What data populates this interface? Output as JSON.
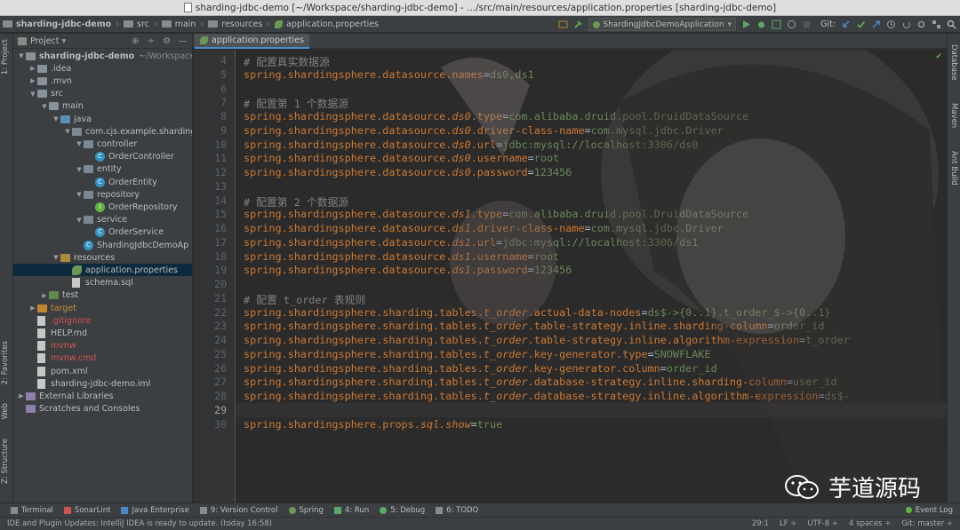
{
  "window": {
    "title": "sharding-jdbc-demo [~/Workspace/sharding-jdbc-demo] - .../src/main/resources/application.properties [sharding-jdbc-demo]"
  },
  "navbar": {
    "crumbs": [
      "sharding-jdbc-demo",
      "src",
      "main",
      "resources",
      "application.properties"
    ],
    "run_config": "ShardingJdbcDemoApplication",
    "git_label": "Git:"
  },
  "left_stripe": {
    "project": "1: Project",
    "favorites": "2: Favorites",
    "web": "Web",
    "structure": "Z: Structure"
  },
  "right_stripe": {
    "database": "Database",
    "maven": "Maven",
    "ant": "Ant Build"
  },
  "project_panel": {
    "header": "Project",
    "tree": [
      {
        "label": "sharding-jdbc-demo",
        "extra": "~/Workspace/s",
        "icon": "folder",
        "indent": 0,
        "arrow": "down",
        "bold": true
      },
      {
        "label": ".idea",
        "icon": "folder",
        "indent": 1,
        "arrow": "right"
      },
      {
        "label": ".mvn",
        "icon": "folder",
        "indent": 1,
        "arrow": "right"
      },
      {
        "label": "src",
        "icon": "folder",
        "indent": 1,
        "arrow": "down"
      },
      {
        "label": "main",
        "icon": "folder",
        "indent": 2,
        "arrow": "down"
      },
      {
        "label": "java",
        "icon": "folder-src",
        "indent": 3,
        "arrow": "down"
      },
      {
        "label": "com.cjs.example.sharding",
        "icon": "pkg",
        "indent": 4,
        "arrow": "down"
      },
      {
        "label": "controller",
        "icon": "pkg",
        "indent": 5,
        "arrow": "down"
      },
      {
        "label": "OrderController",
        "icon": "cls",
        "indent": 6,
        "arrow": ""
      },
      {
        "label": "entity",
        "icon": "pkg",
        "indent": 5,
        "arrow": "down"
      },
      {
        "label": "OrderEntity",
        "icon": "cls",
        "indent": 6,
        "arrow": ""
      },
      {
        "label": "repository",
        "icon": "pkg",
        "indent": 5,
        "arrow": "down"
      },
      {
        "label": "OrderRepository",
        "icon": "itf",
        "indent": 6,
        "arrow": ""
      },
      {
        "label": "service",
        "icon": "pkg",
        "indent": 5,
        "arrow": "down"
      },
      {
        "label": "OrderService",
        "icon": "cls",
        "indent": 6,
        "arrow": ""
      },
      {
        "label": "ShardingJdbcDemoAp",
        "icon": "cls",
        "indent": 5,
        "arrow": ""
      },
      {
        "label": "resources",
        "icon": "folder-res",
        "indent": 3,
        "arrow": "down"
      },
      {
        "label": "application.properties",
        "icon": "leaf",
        "indent": 4,
        "arrow": "",
        "selected": true
      },
      {
        "label": "schema.sql",
        "icon": "file",
        "indent": 4,
        "arrow": ""
      },
      {
        "label": "test",
        "icon": "folder-test",
        "indent": 2,
        "arrow": "right"
      },
      {
        "label": "target",
        "icon": "folder-target",
        "indent": 1,
        "arrow": "right"
      },
      {
        "label": ".gitignore",
        "icon": "file",
        "indent": 1,
        "arrow": "",
        "color": "red"
      },
      {
        "label": "HELP.md",
        "icon": "file",
        "indent": 1,
        "arrow": ""
      },
      {
        "label": "mvnw",
        "icon": "file",
        "indent": 1,
        "arrow": "",
        "color": "red"
      },
      {
        "label": "mvnw.cmd",
        "icon": "file",
        "indent": 1,
        "arrow": "",
        "color": "red"
      },
      {
        "label": "pom.xml",
        "icon": "file",
        "indent": 1,
        "arrow": ""
      },
      {
        "label": "sharding-jdbc-demo.iml",
        "icon": "file",
        "indent": 1,
        "arrow": ""
      },
      {
        "label": "External Libraries",
        "icon": "lib",
        "indent": 0,
        "arrow": "right"
      },
      {
        "label": "Scratches and Consoles",
        "icon": "lib",
        "indent": 0,
        "arrow": ""
      }
    ]
  },
  "editor": {
    "tab": "application.properties",
    "current_line": 29,
    "lines": [
      {
        "n": 4,
        "segs": [
          [
            "cm",
            "# 配置真实数据源"
          ]
        ]
      },
      {
        "n": 5,
        "segs": [
          [
            "k",
            "spring.shardingsphere.datasource.names"
          ],
          [
            "p",
            "="
          ],
          [
            "v",
            "ds0,ds1"
          ]
        ]
      },
      {
        "n": 6,
        "segs": []
      },
      {
        "n": 7,
        "segs": [
          [
            "cm",
            "# 配置第 1 个数据源"
          ]
        ]
      },
      {
        "n": 8,
        "segs": [
          [
            "k",
            "spring.shardingsphere.datasource."
          ],
          [
            "ki",
            "ds0"
          ],
          [
            "k",
            ".type"
          ],
          [
            "p",
            "="
          ],
          [
            "v",
            "com.alibaba.druid.pool.DruidDataSource"
          ]
        ]
      },
      {
        "n": 9,
        "segs": [
          [
            "k",
            "spring.shardingsphere.datasource."
          ],
          [
            "ki",
            "ds0"
          ],
          [
            "k",
            ".driver-class-name"
          ],
          [
            "p",
            "="
          ],
          [
            "v",
            "com.mysql.jdbc.Driver"
          ]
        ]
      },
      {
        "n": 10,
        "segs": [
          [
            "k",
            "spring.shardingsphere.datasource."
          ],
          [
            "ki",
            "ds0"
          ],
          [
            "k",
            ".url"
          ],
          [
            "p",
            "="
          ],
          [
            "v",
            "jdbc:mysql://localhost:3306/ds0"
          ]
        ]
      },
      {
        "n": 11,
        "segs": [
          [
            "k",
            "spring.shardingsphere.datasource."
          ],
          [
            "ki",
            "ds0"
          ],
          [
            "k",
            ".username"
          ],
          [
            "p",
            "="
          ],
          [
            "v",
            "root"
          ]
        ]
      },
      {
        "n": 12,
        "segs": [
          [
            "k",
            "spring.shardingsphere.datasource."
          ],
          [
            "ki",
            "ds0"
          ],
          [
            "k",
            ".password"
          ],
          [
            "p",
            "="
          ],
          [
            "v",
            "123456"
          ]
        ]
      },
      {
        "n": 13,
        "segs": []
      },
      {
        "n": 14,
        "segs": [
          [
            "cm",
            "# 配置第 2 个数据源"
          ]
        ]
      },
      {
        "n": 15,
        "segs": [
          [
            "k",
            "spring.shardingsphere.datasource."
          ],
          [
            "ki",
            "ds1"
          ],
          [
            "k",
            ".type"
          ],
          [
            "p",
            "="
          ],
          [
            "v",
            "com.alibaba.druid.pool.DruidDataSource"
          ]
        ]
      },
      {
        "n": 16,
        "segs": [
          [
            "k",
            "spring.shardingsphere.datasource."
          ],
          [
            "ki",
            "ds1"
          ],
          [
            "k",
            ".driver-class-name"
          ],
          [
            "p",
            "="
          ],
          [
            "v",
            "com.mysql.jdbc.Driver"
          ]
        ]
      },
      {
        "n": 17,
        "segs": [
          [
            "k",
            "spring.shardingsphere.datasource."
          ],
          [
            "ki",
            "ds1"
          ],
          [
            "k",
            ".url"
          ],
          [
            "p",
            "="
          ],
          [
            "v",
            "jdbc:mysql://localhost:3306/ds1"
          ]
        ]
      },
      {
        "n": 18,
        "segs": [
          [
            "k",
            "spring.shardingsphere.datasource."
          ],
          [
            "ki",
            "ds1"
          ],
          [
            "k",
            ".username"
          ],
          [
            "p",
            "="
          ],
          [
            "v",
            "root"
          ]
        ]
      },
      {
        "n": 19,
        "segs": [
          [
            "k",
            "spring.shardingsphere.datasource."
          ],
          [
            "ki",
            "ds1"
          ],
          [
            "k",
            ".password"
          ],
          [
            "p",
            "="
          ],
          [
            "v",
            "123456"
          ]
        ]
      },
      {
        "n": 20,
        "segs": []
      },
      {
        "n": 21,
        "segs": [
          [
            "cm",
            "# 配置 t_order 表规则"
          ]
        ]
      },
      {
        "n": 22,
        "segs": [
          [
            "k",
            "spring.shardingsphere.sharding.tables."
          ],
          [
            "ki",
            "t_order"
          ],
          [
            "k",
            ".actual-data-nodes"
          ],
          [
            "p",
            "="
          ],
          [
            "v",
            "ds$->{0..1}.t_order_$->{0..1}"
          ]
        ]
      },
      {
        "n": 23,
        "segs": [
          [
            "k",
            "spring.shardingsphere.sharding.tables."
          ],
          [
            "ki",
            "t_order"
          ],
          [
            "k",
            ".table-strategy.inline.sharding-column"
          ],
          [
            "p",
            "="
          ],
          [
            "v",
            "order_id"
          ]
        ]
      },
      {
        "n": 24,
        "segs": [
          [
            "k",
            "spring.shardingsphere.sharding.tables."
          ],
          [
            "ki",
            "t_order"
          ],
          [
            "k",
            ".table-strategy.inline.algorithm-expression"
          ],
          [
            "p",
            "="
          ],
          [
            "v",
            "t_order"
          ]
        ]
      },
      {
        "n": 25,
        "segs": [
          [
            "k",
            "spring.shardingsphere.sharding.tables."
          ],
          [
            "ki",
            "t_order"
          ],
          [
            "k",
            ".key-generator.type"
          ],
          [
            "p",
            "="
          ],
          [
            "v",
            "SNOWFLAKE"
          ]
        ]
      },
      {
        "n": 26,
        "segs": [
          [
            "k",
            "spring.shardingsphere.sharding.tables."
          ],
          [
            "ki",
            "t_order"
          ],
          [
            "k",
            ".key-generator.column"
          ],
          [
            "p",
            "="
          ],
          [
            "v",
            "order_id"
          ]
        ]
      },
      {
        "n": 27,
        "segs": [
          [
            "k",
            "spring.shardingsphere.sharding.tables."
          ],
          [
            "ki",
            "t_order"
          ],
          [
            "k",
            ".database-strategy.inline.sharding-column"
          ],
          [
            "p",
            "="
          ],
          [
            "v",
            "user_id"
          ]
        ]
      },
      {
        "n": 28,
        "segs": [
          [
            "k",
            "spring.shardingsphere.sharding.tables."
          ],
          [
            "ki",
            "t_order"
          ],
          [
            "k",
            ".database-strategy.inline.algorithm-expression"
          ],
          [
            "p",
            "="
          ],
          [
            "v",
            "ds$-"
          ]
        ]
      },
      {
        "n": 29,
        "segs": []
      },
      {
        "n": 30,
        "segs": [
          [
            "k",
            "spring.shardingsphere.props."
          ],
          [
            "ki",
            "sql.show"
          ],
          [
            "p",
            "="
          ],
          [
            "v",
            "true"
          ]
        ]
      }
    ]
  },
  "bottom_tools": [
    {
      "label": "Terminal"
    },
    {
      "label": "SonarLint"
    },
    {
      "label": "Java Enterprise"
    },
    {
      "label": "9: Version Control"
    },
    {
      "label": "Spring"
    },
    {
      "label": "4: Run"
    },
    {
      "label": "5: Debug"
    },
    {
      "label": "6: TODO"
    }
  ],
  "event_log": "Event Log",
  "status": {
    "message": "IDE and Plugin Updates: IntelliJ IDEA is ready to update. (today 16:58)",
    "position": "29:1",
    "line_sep": "LF ÷",
    "encoding": "UTF-8 ÷",
    "indent": "4 spaces ÷",
    "branch": "Git: master ÷"
  },
  "watermark": {
    "text": "芋道源码"
  }
}
